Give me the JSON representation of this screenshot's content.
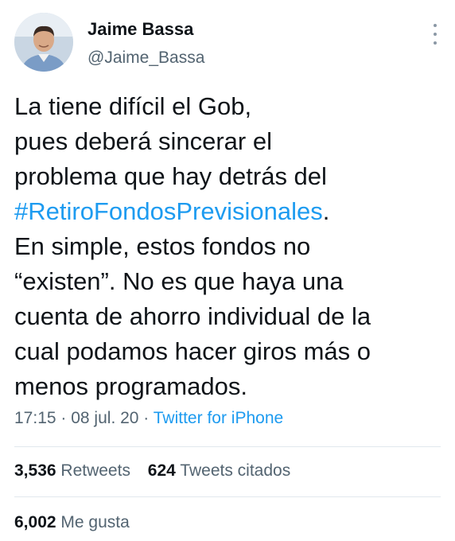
{
  "author": {
    "name": "Jaime Bassa",
    "handle": "@Jaime_Bassa",
    "avatar_icon": "profile-photo"
  },
  "menu": {
    "icon": "more-vertical-icon"
  },
  "tweet": {
    "lines": [
      "La tiene difícil el Gob,",
      "pues deberá sincerar el",
      "problema que hay detrás del"
    ],
    "hashtag": "#RetiroFondosPrevisionales",
    "hashtag_suffix": ".",
    "lines_after": [
      "En simple, estos fondos no",
      "“existen”. No es que haya una",
      "cuenta de ahorro individual de la",
      "cual podamos hacer giros más o",
      "menos programados."
    ]
  },
  "meta": {
    "time": "17:15",
    "separator": " · ",
    "date": "08 jul. 20",
    "source": "Twitter for iPhone"
  },
  "stats": {
    "retweets_count": "3,536",
    "retweets_label": "Retweets",
    "quotes_count": "624",
    "quotes_label": "Tweets citados",
    "likes_count": "6,002",
    "likes_label": "Me gusta"
  },
  "colors": {
    "link": "#1d9bf0",
    "secondary_text": "#536471",
    "primary_text": "#0f1419",
    "divider": "#e1e8ed"
  }
}
